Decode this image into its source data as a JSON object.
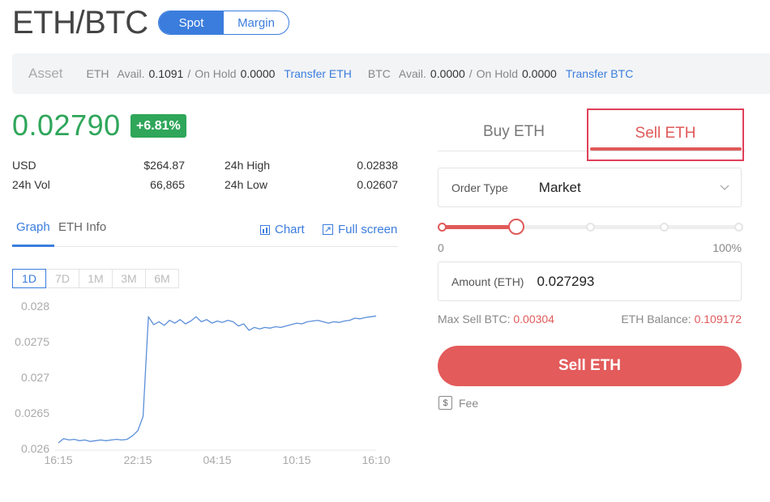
{
  "header": {
    "pair": "ETH/BTC",
    "modes": [
      "Spot",
      "Margin"
    ],
    "active_mode": "Spot"
  },
  "asset_bar": {
    "label": "Asset",
    "eth": {
      "symbol": "ETH",
      "avail_label": "Avail.",
      "avail": "0.1091",
      "hold_label": "On Hold",
      "hold": "0.0000",
      "transfer": "Transfer ETH"
    },
    "btc": {
      "symbol": "BTC",
      "avail_label": "Avail.",
      "avail": "0.0000",
      "hold_label": "On Hold",
      "hold": "0.0000",
      "transfer": "Transfer BTC"
    }
  },
  "ticker": {
    "price": "0.02790",
    "change": "+6.81%",
    "usd_label": "USD",
    "usd": "$264.87",
    "vol_label": "24h Vol",
    "vol": "66,865",
    "high_label": "24h High",
    "high": "0.02838",
    "low_label": "24h Low",
    "low": "0.02607"
  },
  "chart_tabs": {
    "graph": "Graph",
    "info": "ETH Info",
    "chart": "Chart",
    "fullscreen": "Full screen"
  },
  "ranges": [
    "1D",
    "7D",
    "1M",
    "3M",
    "6M"
  ],
  "active_range": "1D",
  "chart_data": {
    "type": "line",
    "x_ticks": [
      "16:15",
      "22:15",
      "04:15",
      "10:15",
      "16:10"
    ],
    "y_ticks": [
      "0.028",
      "0.0275",
      "0.027",
      "0.0265",
      "0.026"
    ],
    "ylim": [
      0.026,
      0.028
    ],
    "grid": false,
    "series": [
      {
        "color": "#5b8fd9",
        "x": [
          0,
          0.4,
          0.8,
          1.2,
          1.6,
          2.0,
          2.4,
          2.8,
          3.2,
          3.6,
          4.0,
          4.4,
          4.8,
          5.2,
          5.6,
          6.0,
          6.4,
          6.8,
          7.2,
          7.6,
          8.0,
          8.4,
          8.8,
          9.2,
          9.6,
          10.0,
          10.4,
          10.8,
          11.2,
          11.6,
          12.0,
          12.4,
          12.8,
          13.2,
          13.6,
          14.0,
          14.4,
          14.8,
          15.2,
          15.6,
          16.0,
          16.4,
          16.8,
          17.2,
          17.6,
          18.0,
          18.4,
          18.8,
          19.2,
          19.6,
          20.0,
          20.4,
          20.8,
          21.2,
          21.6,
          22.0,
          22.4,
          22.8,
          23.2,
          23.6,
          24.0
        ],
        "values": [
          0.02608,
          0.02614,
          0.02612,
          0.02613,
          0.02611,
          0.02612,
          0.0261,
          0.02611,
          0.02612,
          0.02611,
          0.02612,
          0.02613,
          0.02612,
          0.02613,
          0.02618,
          0.02625,
          0.02645,
          0.02785,
          0.02774,
          0.02778,
          0.02773,
          0.0278,
          0.02776,
          0.02781,
          0.02775,
          0.02779,
          0.02785,
          0.02778,
          0.02781,
          0.02776,
          0.02779,
          0.02777,
          0.0278,
          0.02778,
          0.02772,
          0.02775,
          0.02766,
          0.0277,
          0.02768,
          0.0277,
          0.02769,
          0.02771,
          0.0277,
          0.02772,
          0.02774,
          0.02776,
          0.02775,
          0.02778,
          0.02779,
          0.0278,
          0.02778,
          0.02776,
          0.02778,
          0.02777,
          0.02779,
          0.0278,
          0.02783,
          0.02782,
          0.02784,
          0.02785,
          0.02786
        ]
      }
    ]
  },
  "trade": {
    "tabs": [
      "Buy ETH",
      "Sell ETH"
    ],
    "active_tab": "Sell ETH",
    "order_type_label": "Order Type",
    "order_type": "Market",
    "slider_min": "0",
    "slider_max": "100%",
    "slider_value": 0.25,
    "amount_label": "Amount (ETH)",
    "amount": "0.027293",
    "max_sell_label": "Max Sell BTC:",
    "max_sell": "0.00304",
    "balance_label": "ETH Balance:",
    "balance": "0.109172",
    "submit": "Sell ETH",
    "fee": "Fee"
  }
}
